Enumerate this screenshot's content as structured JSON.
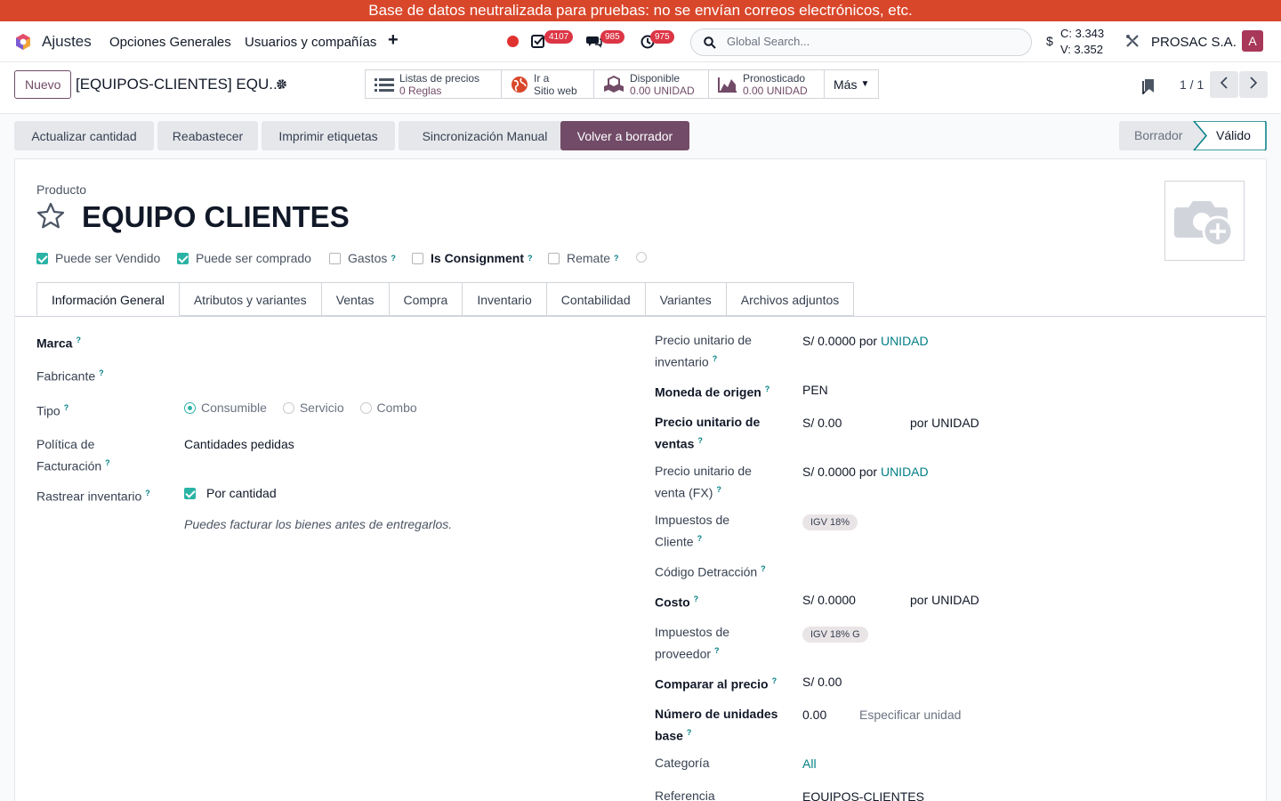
{
  "banner": "Base de datos neutralizada para pruebas: no se envían correos electrónicos, etc.",
  "nav": {
    "app_name": "Ajustes",
    "menu": [
      "Opciones Generales",
      "Usuarios y compañías"
    ],
    "badges": {
      "activities": "4107",
      "messages": "985",
      "timers": "975"
    },
    "search_placeholder": "Global Search...",
    "currency_symbol": "$",
    "rate_c": "C: 3.343",
    "rate_v": "V: 3.352",
    "company": "PROSAC S.A.",
    "avatar_letter": "A"
  },
  "control": {
    "new_button": "Nuevo",
    "breadcrumb": "[EQUIPOS-CLIENTES] EQU...",
    "smart_buttons": [
      {
        "title": "Listas de precios",
        "value": "0  Reglas",
        "icon": "list-icon"
      },
      {
        "title": "Ir a",
        "value": "Sitio web",
        "icon": "globe-icon"
      },
      {
        "title": "Disponible",
        "value": "0.00 UNIDAD",
        "icon": "cubes-icon"
      },
      {
        "title": "Pronosticado",
        "value": "0.00 UNIDAD",
        "icon": "area-chart-icon"
      }
    ],
    "more": "Más",
    "pager": "1 / 1"
  },
  "actions": [
    "Actualizar cantidad",
    "Reabastecer",
    "Imprimir etiquetas",
    "Sincronización Manual",
    "Volver a borrador"
  ],
  "status": {
    "stages": [
      "Borrador",
      "Válido"
    ],
    "active": "Válido"
  },
  "product": {
    "label": "Producto",
    "name": "EQUIPO CLIENTES",
    "flags": [
      {
        "label": "Puede ser Vendido",
        "checked": true
      },
      {
        "label": "Puede ser comprado",
        "checked": true
      },
      {
        "label": "Gastos",
        "checked": false
      },
      {
        "label": "Is Consignment",
        "checked": false
      },
      {
        "label": "Remate",
        "checked": false
      }
    ]
  },
  "tabs": [
    "Información General",
    "Atributos y variantes",
    "Ventas",
    "Compra",
    "Inventario",
    "Contabilidad",
    "Variantes",
    "Archivos adjuntos"
  ],
  "left": {
    "marca": "Marca",
    "fabricante": "Fabricante",
    "tipo": "Tipo",
    "tipo_options": [
      "Consumible",
      "Servicio",
      "Combo"
    ],
    "tipo_selected": "Consumible",
    "politica_l1": "Política de",
    "politica_l2": "Facturación",
    "politica_value": "Cantidades pedidas",
    "rastrear": "Rastrear inventario",
    "rastrear_value": "Por cantidad",
    "hint": "Puedes facturar los bienes antes de entregarlos."
  },
  "right": {
    "pu_inv_l1": "Precio unitario de",
    "pu_inv_l2": "inventario",
    "pu_inv_val": "S/ 0.0000 por",
    "pu_inv_unit": "UNIDAD",
    "moneda_label": "Moneda de origen",
    "moneda_val": "PEN",
    "pu_ventas_l1": "Precio unitario de",
    "pu_ventas_l2": "ventas",
    "pu_ventas_val": "S/ 0.00",
    "pu_ventas_unit": "por UNIDAD",
    "pu_fx_l1": "Precio unitario de",
    "pu_fx_l2": "venta (FX)",
    "pu_fx_val": "S/ 0.0000 por",
    "pu_fx_unit": "UNIDAD",
    "imp_cli_l1": "Impuestos de",
    "imp_cli_l2": "Cliente",
    "imp_cli_tag": "IGV 18%",
    "detraccion": "Código Detracción",
    "costo_label": "Costo",
    "costo_val": "S/ 0.0000",
    "costo_unit": "por UNIDAD",
    "imp_prov_l1": "Impuestos de",
    "imp_prov_l2": "proveedor",
    "imp_prov_tag": "IGV 18% G",
    "comparar_label": "Comparar al precio",
    "comparar_val": "S/ 0.00",
    "unidades_l1": "Número de unidades",
    "unidades_l2": "base",
    "unidades_val": "0.00",
    "unidades_placeholder": "Especificar unidad",
    "categoria_label": "Categoría",
    "categoria_val": "All",
    "referencia_label": "Referencia",
    "referencia_val": "EQUIPOS-CLIENTES"
  },
  "colors": {
    "brand": "#714b67",
    "accent": "#017e84",
    "banner": "#d9472b",
    "check": "#2bb3a5"
  }
}
